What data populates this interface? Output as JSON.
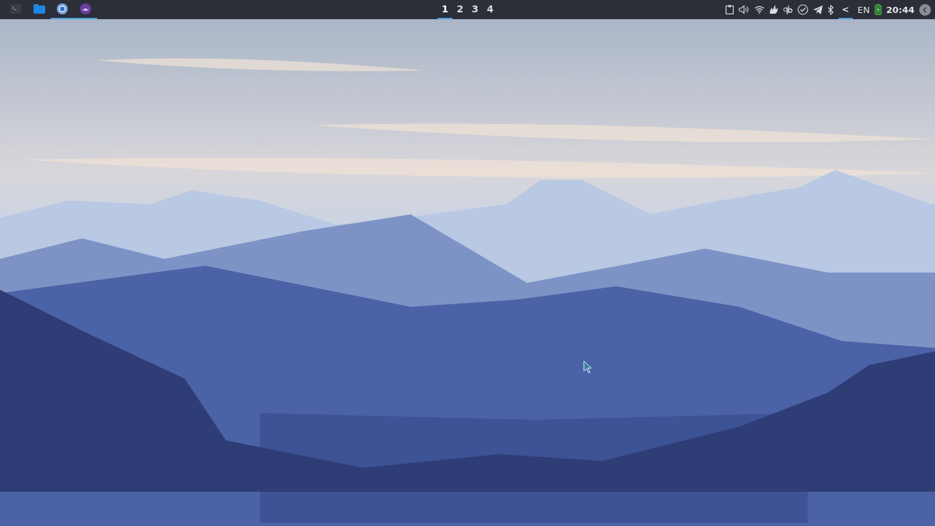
{
  "panel": {
    "launchers": [
      {
        "kind": "terminal",
        "running": false
      },
      {
        "kind": "files",
        "running": false
      },
      {
        "kind": "browser",
        "running": true
      },
      {
        "kind": "app",
        "running": true
      }
    ],
    "workspaces": [
      {
        "label": "1",
        "selected": true
      },
      {
        "label": "2",
        "selected": false
      },
      {
        "label": "3",
        "selected": false
      },
      {
        "label": "4",
        "selected": false
      }
    ],
    "tray": [
      {
        "kind": "clipboard"
      },
      {
        "kind": "volume"
      },
      {
        "kind": "wifi"
      },
      {
        "kind": "flame"
      },
      {
        "kind": "torrent"
      },
      {
        "kind": "check"
      },
      {
        "kind": "plane"
      },
      {
        "kind": "bluetooth"
      }
    ],
    "tray_toggle": {
      "label": "<",
      "selected": true
    },
    "language": "EN",
    "battery": {
      "kind": "charging"
    },
    "clock": "20:44"
  }
}
